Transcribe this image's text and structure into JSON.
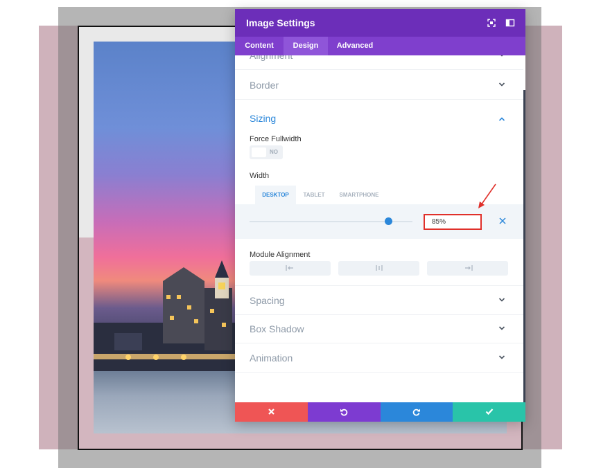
{
  "panel": {
    "title": "Image Settings",
    "tabs": [
      {
        "label": "Content",
        "active": false
      },
      {
        "label": "Design",
        "active": true
      },
      {
        "label": "Advanced",
        "active": false
      }
    ]
  },
  "sections": {
    "alignment": "Alignment",
    "border": "Border",
    "sizing": "Sizing",
    "spacing": "Spacing",
    "box_shadow": "Box Shadow",
    "animation": "Animation"
  },
  "sizing": {
    "force_fullwidth_label": "Force Fullwidth",
    "force_fullwidth_value": "NO",
    "width_label": "Width",
    "device_tabs": [
      {
        "label": "DESKTOP",
        "active": true
      },
      {
        "label": "TABLET",
        "active": false
      },
      {
        "label": "SMARTPHONE",
        "active": false
      }
    ],
    "width_value": "85%",
    "slider_fraction": 0.85,
    "module_alignment_label": "Module Alignment"
  },
  "colors": {
    "header": "#6c2eb9",
    "tabs": "#7f3fcd",
    "accent": "#2b87da",
    "cancel": "#ef5555",
    "undo": "#7d3bd1",
    "redo": "#2b87da",
    "save": "#29c4a9",
    "highlight": "#e0302a"
  },
  "icons": {
    "header": [
      "fullscreen-icon",
      "sidebar-toggle-icon"
    ],
    "footer": [
      "close-icon",
      "undo-icon",
      "redo-icon",
      "check-icon"
    ],
    "alignment": [
      "align-left-icon",
      "align-center-icon",
      "align-right-icon"
    ]
  }
}
